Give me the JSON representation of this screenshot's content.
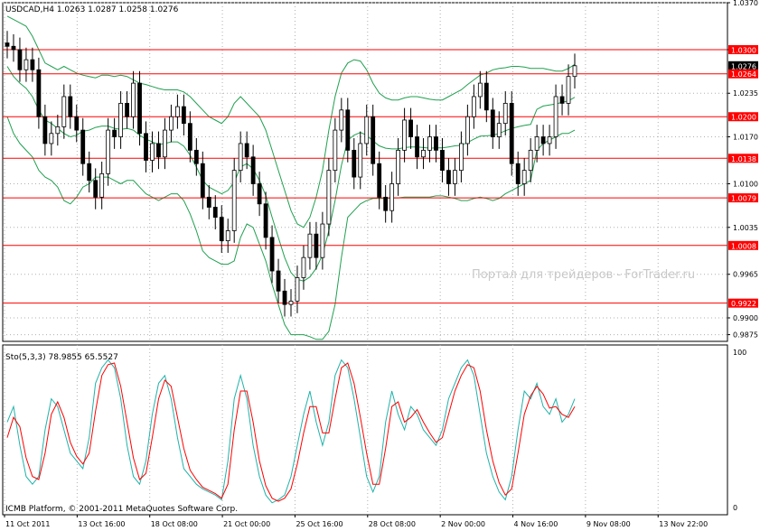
{
  "chart_data": {
    "type": "candlestick",
    "price_panel": {
      "header": "USDCAD,H4  1.0263 1.0287 1.0258 1.0276",
      "ylim": [
        0.9865,
        1.037
      ],
      "y_ticks": [
        "1.0370",
        "1.0300",
        "1.0235",
        "1.0170",
        "1.0100",
        "1.0035",
        "0.9965",
        "0.9900",
        "0.9875"
      ],
      "horizontal_levels": [
        {
          "value": 1.03,
          "label": "1.0300"
        },
        {
          "value": 1.0264,
          "label": "1.0264"
        },
        {
          "value": 1.02,
          "label": "1.0200"
        },
        {
          "value": 1.0138,
          "label": "1.0138"
        },
        {
          "value": 1.0079,
          "label": "1.0079"
        },
        {
          "value": 1.0008,
          "label": "1.0008"
        },
        {
          "value": 0.9922,
          "label": "0.9922"
        }
      ],
      "current_price_label": "1.0276",
      "watermark": "Портал для трейдеров - ForTrader.ru",
      "close_series": [
        1.0305,
        1.03,
        1.027,
        1.0285,
        1.027,
        1.02,
        1.016,
        1.0175,
        1.0185,
        1.023,
        1.02,
        1.018,
        1.013,
        1.0105,
        1.008,
        1.0115,
        1.018,
        1.017,
        1.022,
        1.02,
        1.025,
        1.0175,
        1.0135,
        1.016,
        1.014,
        1.018,
        1.02,
        1.0215,
        1.019,
        1.015,
        1.013,
        1.008,
        1.0065,
        1.005,
        1.0015,
        1.003,
        1.012,
        1.016,
        1.014,
        1.01,
        1.007,
        1.002,
        0.997,
        0.994,
        0.992,
        0.9925,
        0.996,
        0.999,
        1.0025,
        0.999,
        1.004,
        1.012,
        1.018,
        1.021,
        1.015,
        1.011,
        1.016,
        1.02,
        1.013,
        1.008,
        1.006,
        1.01,
        1.015,
        1.0195,
        1.017,
        1.014,
        1.015,
        1.017,
        1.015,
        1.012,
        1.01,
        1.012,
        1.016,
        1.02,
        1.023,
        1.025,
        1.021,
        1.017,
        1.019,
        1.022,
        1.013,
        1.01,
        1.012,
        1.015,
        1.017,
        1.016,
        1.017,
        1.023,
        1.022,
        1.026,
        1.0276
      ],
      "upper_band": [
        1.035,
        1.0345,
        1.034,
        1.0335,
        1.032,
        1.03,
        1.028,
        1.0275,
        1.027,
        1.0275,
        1.027,
        1.0265,
        1.0262,
        1.026,
        1.0258,
        1.0262,
        1.0262,
        1.026,
        1.0262,
        1.026,
        1.0255,
        1.025,
        1.0248,
        1.0245,
        1.0242,
        1.024,
        1.024,
        1.024,
        1.0237,
        1.023,
        1.022,
        1.021,
        1.02,
        1.0195,
        1.019,
        1.02,
        1.022,
        1.023,
        1.022,
        1.021,
        1.02,
        1.018,
        1.015,
        1.012,
        1.009,
        1.006,
        1.004,
        1.0035,
        1.005,
        1.008,
        1.012,
        1.018,
        1.023,
        1.0265,
        1.028,
        1.0285,
        1.0283,
        1.027,
        1.025,
        1.0235,
        1.0228,
        1.0225,
        1.0225,
        1.0228,
        1.023,
        1.023,
        1.0228,
        1.0226,
        1.0225,
        1.0225,
        1.023,
        1.0235,
        1.024,
        1.0248,
        1.0255,
        1.0262,
        1.0265,
        1.027,
        1.0272,
        1.0273,
        1.0275,
        1.0275,
        1.0274,
        1.0272,
        1.0272,
        1.0272,
        1.027,
        1.0268,
        1.0268,
        1.0272,
        1.0278
      ],
      "lower_band": [
        1.02,
        1.0175,
        1.016,
        1.015,
        1.014,
        1.012,
        1.011,
        1.0105,
        1.0095,
        1.0075,
        1.007,
        1.008,
        1.0095,
        1.01,
        1.011,
        1.011,
        1.011,
        1.0105,
        1.01,
        1.0105,
        1.0105,
        1.0095,
        1.0085,
        1.008,
        1.0075,
        1.008,
        1.0085,
        1.0085,
        1.0075,
        1.0055,
        1.003,
        1.0,
        0.999,
        0.9985,
        0.998,
        0.998,
        0.9985,
        1.002,
        1.004,
        1.0035,
        1.001,
        0.9985,
        0.995,
        0.992,
        0.989,
        0.9875,
        0.9875,
        0.9875,
        0.9872,
        0.9868,
        0.9868,
        0.988,
        0.992,
        0.999,
        1.005,
        1.006,
        1.007,
        1.0075,
        1.0078,
        1.0078,
        1.0078,
        1.0079,
        1.0079,
        1.008,
        1.008,
        1.008,
        1.008,
        1.008,
        1.0082,
        1.0082,
        1.008,
        1.0078,
        1.0075,
        1.0075,
        1.0078,
        1.008,
        1.0078,
        1.0075,
        1.0078,
        1.0085,
        1.009,
        1.0095,
        1.01,
        1.0105,
        1.015,
        1.016,
        1.0165,
        1.017,
        1.0175,
        1.0175,
        1.018
      ]
    },
    "stochastic_panel": {
      "header": "Sto(5,3,3) 78.9855 65.5527",
      "ylim": [
        0,
        100
      ],
      "y_ticks": [
        "100",
        "0"
      ],
      "series": [
        {
          "name": "%K",
          "color": "#20b2aa",
          "values": [
            55,
            65,
            40,
            20,
            15,
            20,
            50,
            70,
            65,
            50,
            35,
            30,
            25,
            45,
            80,
            90,
            95,
            90,
            70,
            40,
            20,
            15,
            30,
            60,
            80,
            85,
            70,
            45,
            25,
            20,
            15,
            12,
            10,
            8,
            5,
            30,
            70,
            85,
            70,
            40,
            20,
            8,
            3,
            5,
            8,
            20,
            40,
            60,
            75,
            55,
            40,
            55,
            85,
            95,
            90,
            70,
            45,
            20,
            10,
            20,
            55,
            75,
            60,
            50,
            65,
            60,
            50,
            45,
            40,
            50,
            70,
            80,
            90,
            95,
            85,
            60,
            35,
            20,
            10,
            5,
            20,
            50,
            75,
            70,
            80,
            65,
            60,
            70,
            55,
            60,
            70
          ]
        },
        {
          "name": "%D",
          "color": "#ff0000",
          "values": [
            45,
            58,
            52,
            32,
            20,
            18,
            35,
            60,
            68,
            58,
            42,
            33,
            28,
            35,
            62,
            85,
            92,
            93,
            78,
            55,
            32,
            18,
            22,
            45,
            70,
            82,
            78,
            58,
            38,
            24,
            18,
            13,
            11,
            9,
            6,
            15,
            50,
            75,
            75,
            55,
            30,
            14,
            6,
            4,
            6,
            12,
            28,
            48,
            65,
            65,
            48,
            48,
            70,
            90,
            93,
            80,
            58,
            35,
            15,
            15,
            38,
            65,
            68,
            55,
            58,
            63,
            55,
            48,
            42,
            45,
            60,
            75,
            85,
            92,
            90,
            75,
            50,
            30,
            16,
            8,
            12,
            35,
            60,
            72,
            78,
            73,
            64,
            65,
            60,
            58,
            65
          ]
        }
      ]
    },
    "x_tick_labels": [
      "11 Oct 2011",
      "13 Oct 16:00",
      "18 Oct 08:00",
      "21 Oct 00:00",
      "25 Oct 16:00",
      "28 Oct 08:00",
      "2 Nov 00:00",
      "4 Nov 16:00",
      "9 Nov 08:00",
      "13 Nov 22:00"
    ],
    "copyright": "ICMB Platform, © 2001-2011 MetaQuotes Software Corp.",
    "grid": true,
    "colors": {
      "levels": "#ff0000",
      "bands": "#20a050",
      "candles": "#000000",
      "axis_label_bg": "#ff0000",
      "current_label_bg": "#000000"
    }
  }
}
